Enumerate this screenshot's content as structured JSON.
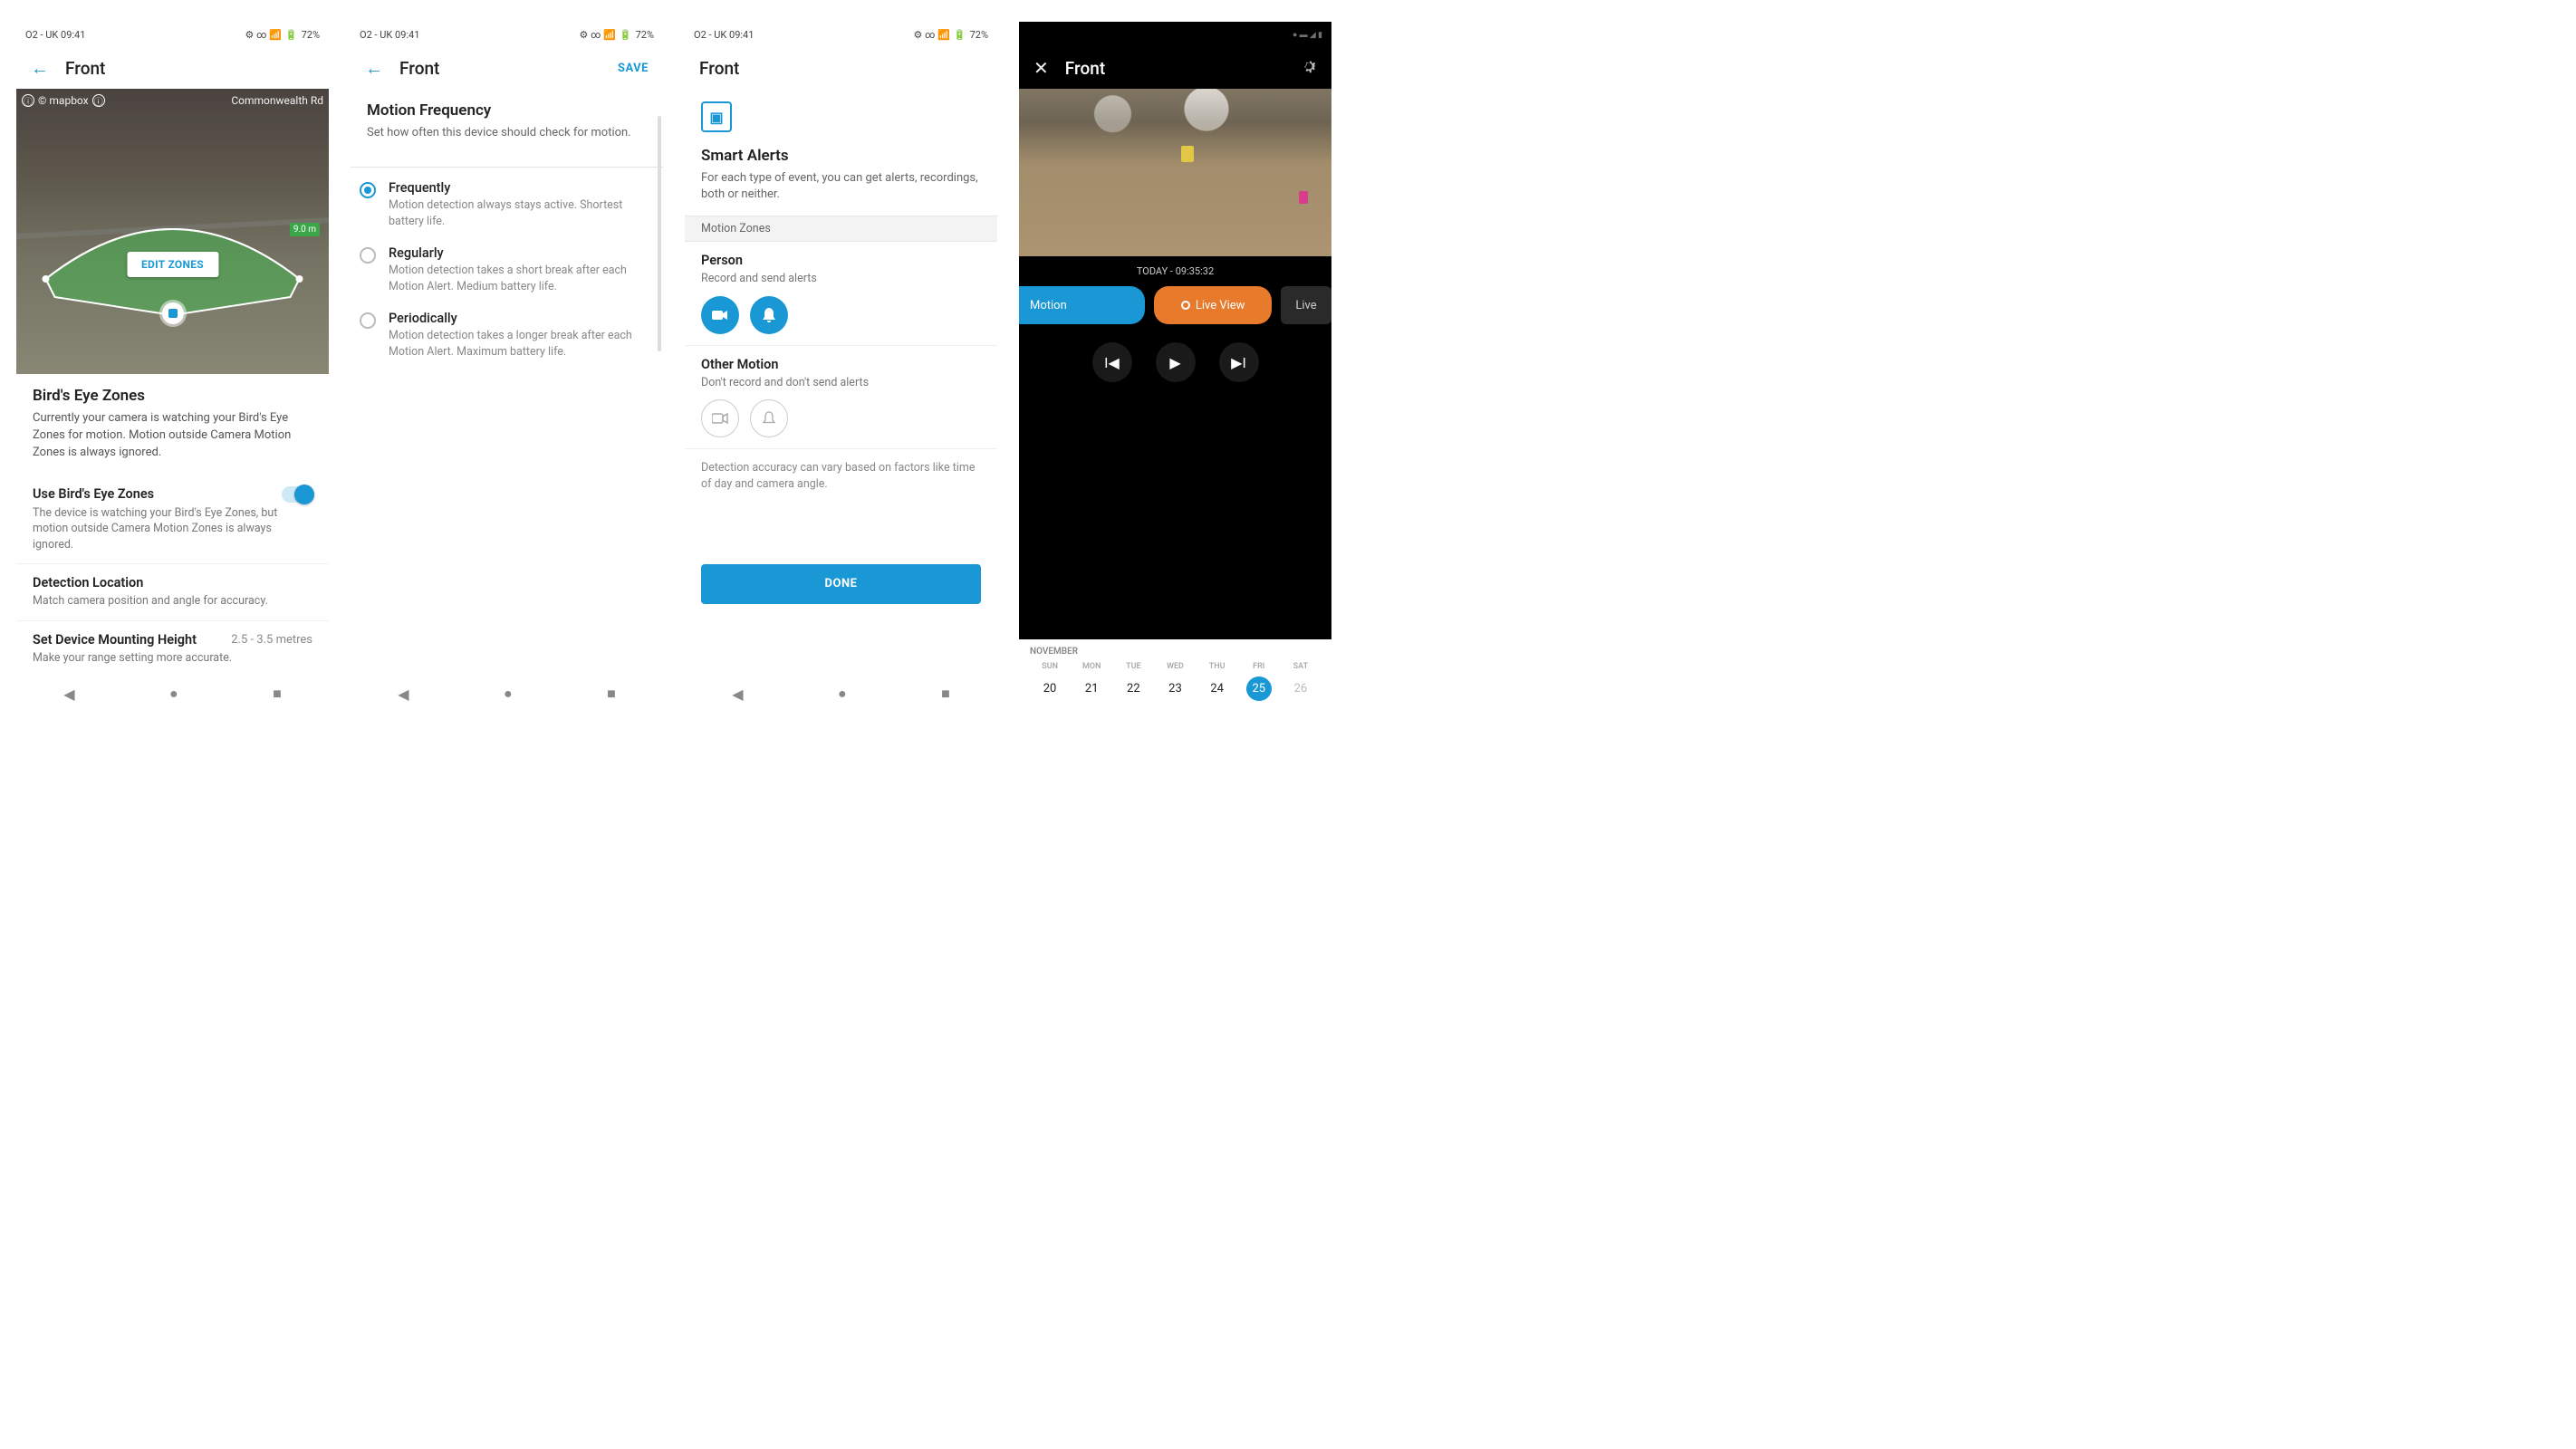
{
  "status": {
    "carrier": "O2 - UK 09:41",
    "battery": "72%",
    "battery_icon": "▮",
    "signal": "◢",
    "extras": "⚙ ∞ 📶"
  },
  "screen1": {
    "title": "Front",
    "overlay_map_label": "© mapbox",
    "overlay_road": "Commonwealth Rd",
    "edit_zones": "EDIT ZONES",
    "distance": "9.0 m",
    "bez_title": "Bird's Eye Zones",
    "bez_desc": "Currently your camera is watching your Bird's Eye Zones for motion. Motion outside Camera Motion Zones is always ignored.",
    "use_bez_title": "Use Bird's Eye Zones",
    "use_bez_desc": "The device is watching your Bird's Eye Zones, but motion outside Camera Motion Zones is always ignored.",
    "detloc_title": "Detection Location",
    "detloc_desc": "Match camera position and angle for accuracy.",
    "mount_title": "Set Device Mounting Height",
    "mount_val": "2.5 - 3.5 metres",
    "mount_desc": "Make your range setting more accurate."
  },
  "screen2": {
    "title": "Front",
    "save": "SAVE",
    "mf_title": "Motion Frequency",
    "mf_desc": "Set how often this device should check for motion.",
    "options": [
      {
        "title": "Frequently",
        "desc": "Motion detection always stays active. Shortest battery life.",
        "selected": true
      },
      {
        "title": "Regularly",
        "desc": "Motion detection takes a short break after each Motion Alert. Medium battery life.",
        "selected": false
      },
      {
        "title": "Periodically",
        "desc": "Motion detection takes a longer break after each Motion Alert. Maximum battery life.",
        "selected": false
      }
    ]
  },
  "screen3": {
    "title": "Front",
    "sa_title": "Smart Alerts",
    "sa_desc": "For each type of event, you can get alerts, recordings, both or neither.",
    "section": "Motion Zones",
    "person_title": "Person",
    "person_sub": "Record and send alerts",
    "other_title": "Other Motion",
    "other_sub": "Don't record and don't send alerts",
    "accuracy": "Detection accuracy can vary based on factors like time of day and camera angle.",
    "done": "DONE"
  },
  "screen4": {
    "title": "Front",
    "timestamp": "TODAY - 09:35:32",
    "chip_motion": "Motion",
    "chip_liveview": "Live View",
    "chip_live": "Live",
    "month": "NOVEMBER",
    "day_names": [
      "SUN",
      "MON",
      "TUE",
      "WED",
      "THU",
      "FRI",
      "SAT"
    ],
    "days": [
      {
        "n": "20"
      },
      {
        "n": "21"
      },
      {
        "n": "22"
      },
      {
        "n": "23"
      },
      {
        "n": "24"
      },
      {
        "n": "25",
        "selected": true
      },
      {
        "n": "26",
        "dim": true
      }
    ]
  }
}
